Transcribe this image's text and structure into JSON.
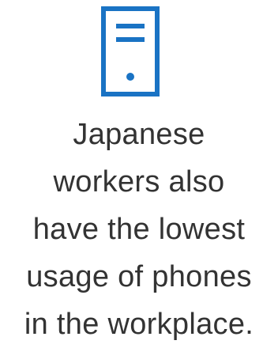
{
  "icon": {
    "name": "phone-icon",
    "color": "#1a73c4"
  },
  "caption": {
    "lines": [
      "Japanese",
      "workers also",
      "have the lowest",
      "usage of phones",
      "in the workplace."
    ],
    "color": "#333333"
  }
}
